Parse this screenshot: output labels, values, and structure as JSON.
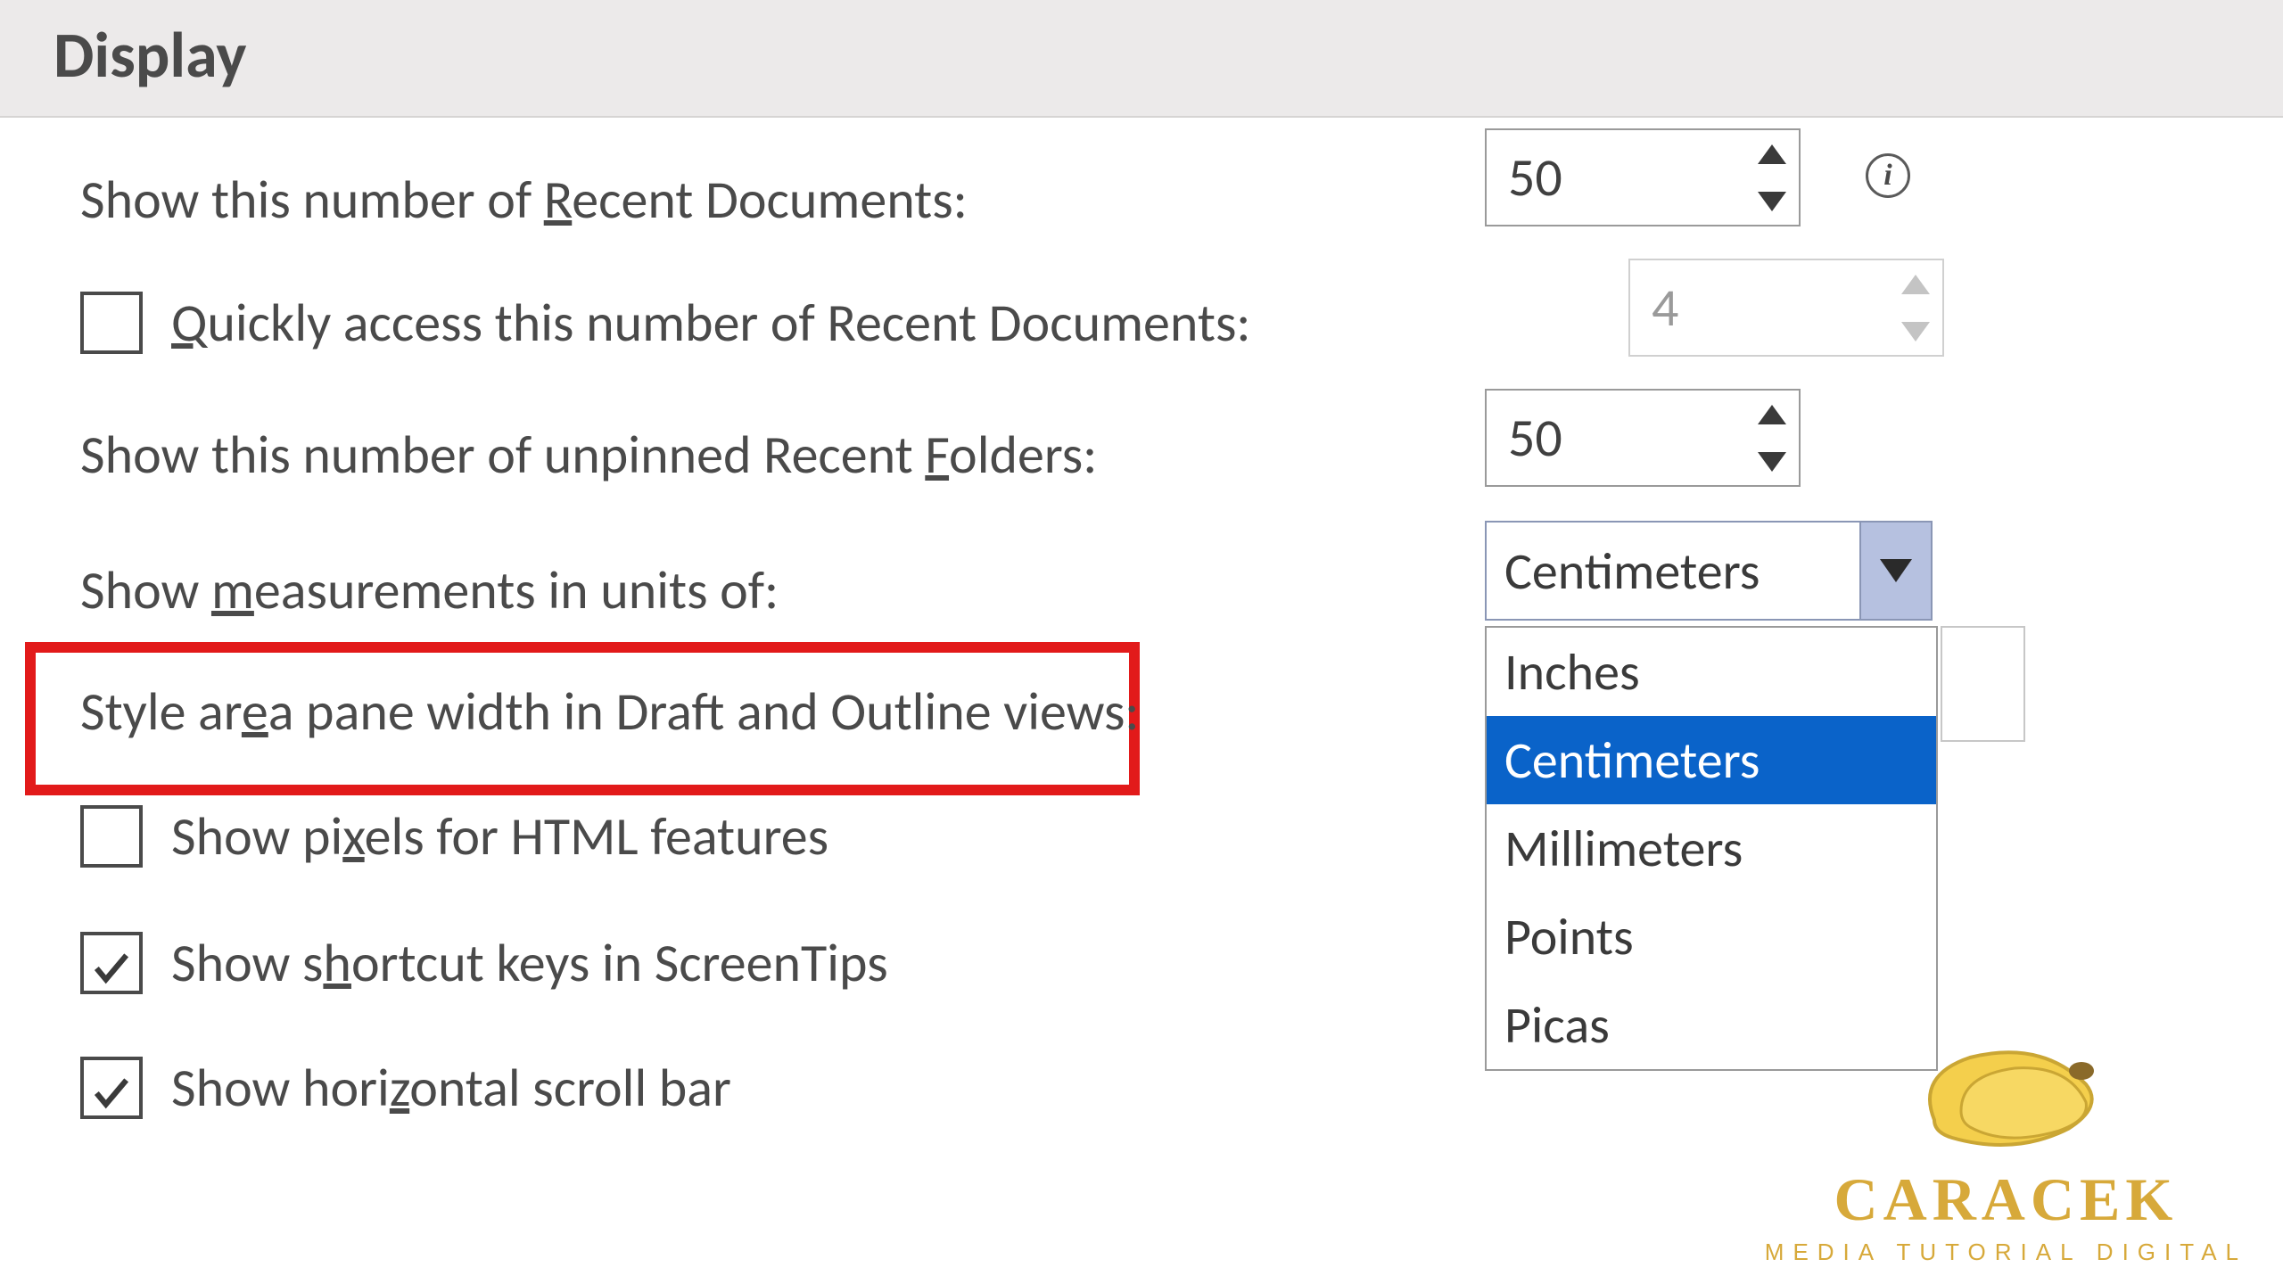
{
  "section_title": "Display",
  "rows": {
    "recent_docs": {
      "label_pre": "Show this number of ",
      "label_u": "R",
      "label_post": "ecent Documents:",
      "value": "50"
    },
    "quick_access": {
      "label_pre": "",
      "label_u": "Q",
      "label_post": "uickly access this number of Recent Documents:",
      "value": "4",
      "checked": false
    },
    "recent_folders": {
      "label_pre": "Show this number of unpinned Recent ",
      "label_u": "F",
      "label_post": "olders:",
      "value": "50"
    },
    "measurements": {
      "label_pre": "Show ",
      "label_u": "m",
      "label_post": "easurements in units of:",
      "value": "Centimeters"
    },
    "style_pane": {
      "label_pre": "Style ar",
      "label_u": "e",
      "label_post": "a pane width in Draft and Outline views:"
    },
    "pixels_html": {
      "label_pre": "Show pi",
      "label_u": "x",
      "label_post": "els for HTML features",
      "checked": false
    },
    "shortcut_keys": {
      "label_pre": "Show s",
      "label_u": "h",
      "label_post": "ortcut keys in ScreenTips",
      "checked": true
    },
    "h_scroll": {
      "label_pre": "Show hori",
      "label_u": "z",
      "label_post": "ontal scroll bar",
      "checked": true
    }
  },
  "units_options": [
    "Inches",
    "Centimeters",
    "Millimeters",
    "Points",
    "Picas"
  ],
  "units_selected": "Centimeters",
  "watermark": {
    "brand": "CARACEK",
    "tagline": "MEDIA TUTORIAL DIGITAL"
  }
}
